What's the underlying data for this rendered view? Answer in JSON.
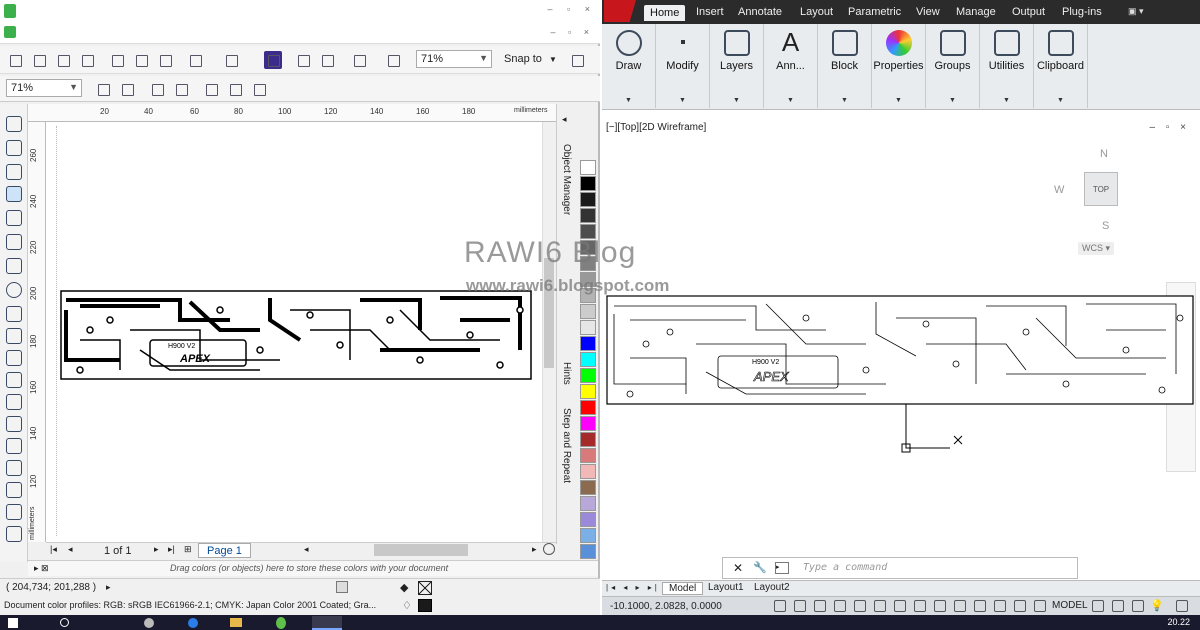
{
  "left_app": {
    "zoom_level_top": "71%",
    "zoom_level_view": "71%",
    "snap_label": "Snap to",
    "ruler_unit": "millimeters",
    "h_ruler_ticks": [
      "20",
      "40",
      "60",
      "80",
      "100",
      "120",
      "140",
      "160",
      "180"
    ],
    "v_ruler_ticks": [
      "260",
      "240",
      "220",
      "200",
      "180",
      "160",
      "140",
      "120"
    ],
    "docker_tabs": [
      "Object Manager",
      "Hints",
      "Step and Repeat"
    ],
    "page_count": "1 of 1",
    "page_tab": "Page 1",
    "color_tray_hint": "Drag colors (or objects) here to store these colors with your document",
    "cursor_coords": "( 204,734; 201,288 )",
    "color_profiles": "Document color profiles: RGB: sRGB IEC61966-2.1; CMYK: Japan Color 2001 Coated; Gra...",
    "board_title": "H900 V2",
    "board_brand": "APEX",
    "palette": [
      "#ffffff",
      "#000000",
      "#1a1a1a",
      "#333333",
      "#4d4d4d",
      "#666666",
      "#808080",
      "#999999",
      "#b3b3b3",
      "#cccccc",
      "#e6e6e6",
      "#0000ff",
      "#00ffff",
      "#00ff00",
      "#ffff00",
      "#ff0000",
      "#ff00ff",
      "#a52a2a",
      "#d97a7a",
      "#f2b8b8",
      "#8b6b4f",
      "#b8a8d9",
      "#9b8ad9",
      "#7ab0e6",
      "#5a8fd9"
    ]
  },
  "right_app": {
    "tabs": [
      "Home",
      "Insert",
      "Annotate",
      "Layout",
      "Parametric",
      "View",
      "Manage",
      "Output",
      "Plug-ins"
    ],
    "panels": [
      "Draw",
      "Modify",
      "Layers",
      "Ann...",
      "Block",
      "Properties",
      "Groups",
      "Utilities",
      "Clipboard"
    ],
    "viewport_label": "[−][Top][2D Wireframe]",
    "viewcube": {
      "north": "N",
      "south": "S",
      "west": "W",
      "face": "TOP",
      "ucs": "WCS"
    },
    "command_placeholder": "Type a command",
    "layout_tabs": [
      "Model",
      "Layout1",
      "Layout2"
    ],
    "coords": "-10.1000, 2.0828, 0.0000",
    "model_label": "MODEL",
    "board_title": "H900 V2",
    "board_brand": "APEX"
  },
  "overlay": {
    "watermark_title": "RAWI6 Blog",
    "watermark_url": "www.rawi6.blogspot.com"
  },
  "taskbar": {
    "time": "20.22"
  }
}
